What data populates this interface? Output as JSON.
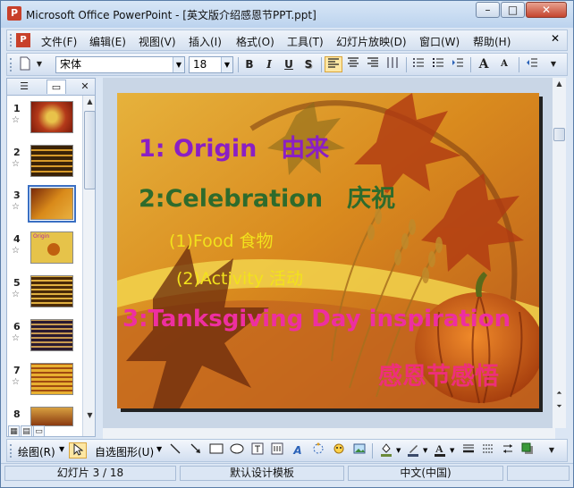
{
  "window": {
    "title": "Microsoft Office PowerPoint - [英文版介绍感恩节PPT.ppt]",
    "app_icon_letter": "P",
    "min_glyph": "–",
    "max_glyph": "□",
    "close_glyph": "✕"
  },
  "menubar": {
    "items": [
      "文件(F)",
      "编辑(E)",
      "视图(V)",
      "插入(I)",
      "格式(O)",
      "工具(T)",
      "幻灯片放映(D)",
      "窗口(W)",
      "帮助(H)"
    ]
  },
  "formatting": {
    "font_name": "宋体",
    "font_size": "18",
    "bold": "B",
    "italic": "I",
    "underline": "U",
    "shadow": "S",
    "grow_font": "A",
    "shrink_font": "A"
  },
  "left_pane": {
    "close_glyph": "✕",
    "thumbnails": [
      {
        "num": "1"
      },
      {
        "num": "2"
      },
      {
        "num": "3"
      },
      {
        "num": "4"
      },
      {
        "num": "5"
      },
      {
        "num": "6"
      },
      {
        "num": "7"
      },
      {
        "num": "8"
      }
    ],
    "star_glyph": "☆",
    "thumb4_caption": "Origin"
  },
  "slide": {
    "line1": "1: Origin　由来",
    "line2": "2:Celebration　庆祝",
    "line3": "(1)Food  食物",
    "line4": "(2)Activity  活动",
    "line5": "3:Tanksgiving Day inspiration",
    "line6": "感恩节感悟",
    "colors": {
      "line1": "#8b1fc4",
      "line2": "#2e6b2c",
      "line3": "#f2e21c",
      "line4": "#f2e21c",
      "line5": "#ee2fa0",
      "line6": "#ee2f7a"
    }
  },
  "drawing_bar": {
    "draw_label": "绘图(R)",
    "autoshapes_label": "自选图形(U)"
  },
  "status": {
    "slide_position": "幻灯片 3 / 18",
    "design": "默认设计模板",
    "language": "中文(中国)"
  }
}
